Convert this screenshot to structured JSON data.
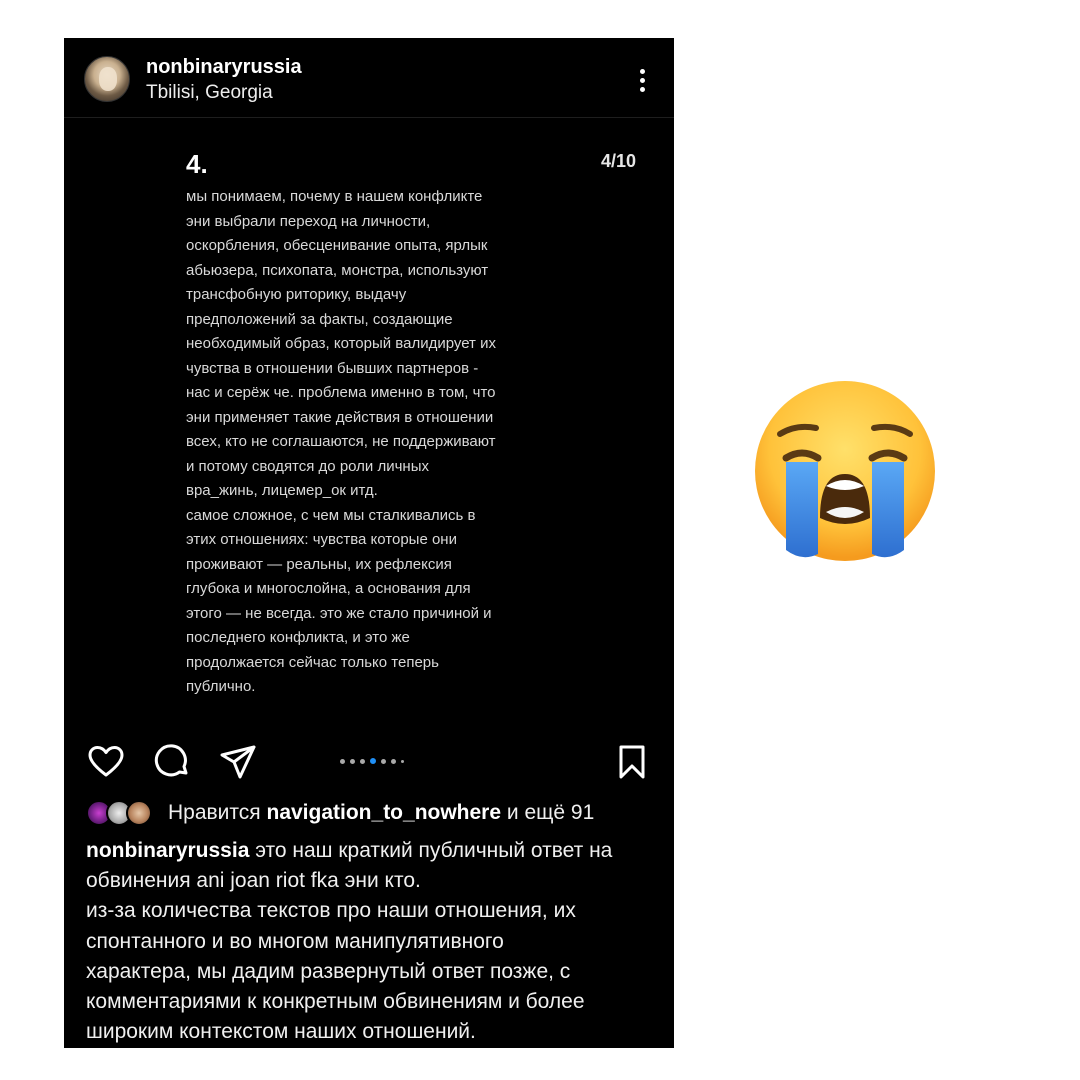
{
  "post": {
    "username": "nonbinaryrussia",
    "location": "Tbilisi, Georgia",
    "more_icon": "more-vertical-icon"
  },
  "slide": {
    "number": "4.",
    "counter": "4/10",
    "text": "мы понимаем, почему в нашем конфликте\nэни выбрали переход на личности,\nоскорбления, обесценивание опыта, ярлык\nабьюзера, психопата, монстра, используют\nтрансфобную риторику, выдачу\nпредположений за факты, создающие\nнеобходимый образ, который валидирует их\nчувства в отношении бывших партнеров -\nнас и серёж че. проблема именно в том, что\nэни применяет такие действия в отношении\nвсех, кто не соглашаются, не поддерживают\nи потому сводятся до роли личных\nвра_жинь, лицемер_ок итд.\nсамое сложное, с чем мы сталкивались в\nэтих отношениях: чувства которые они\nпроживают — реальны, их рефлексия\nглубока и многослойна, а основания для\nэтого — не всегда. это же стало причиной и\nпоследнего конфликта, и это же\nпродолжается сейчас только теперь\nпублично."
  },
  "actions": {
    "like_icon": "heart-icon",
    "comment_icon": "comment-icon",
    "share_icon": "send-icon",
    "save_icon": "bookmark-icon",
    "carousel_total": 10,
    "carousel_active": 4
  },
  "likes": {
    "prefix": "Нравится ",
    "user": "navigation_to_nowhere",
    "suffix": " и ещё 91"
  },
  "caption": {
    "username": "nonbinaryrussia",
    "text": " это наш краткий публичный ответ на\nобвинения ani joan riot fka эни кто.\nиз-за количества текстов про наши отношения, их\nспонтанного и во многом манипулятивного\nхарактера, мы дадим развернутый ответ позже, с\nкомментариями к конкретным обвинениям и более\nшироким контекстом наших отношений."
  },
  "colors": {
    "background": "#000000",
    "accent_dot": "#1f8ff5",
    "emoji_face": "#ffc83a",
    "tears": "#3b8de6"
  },
  "emoji_name": "loudly-crying-face"
}
